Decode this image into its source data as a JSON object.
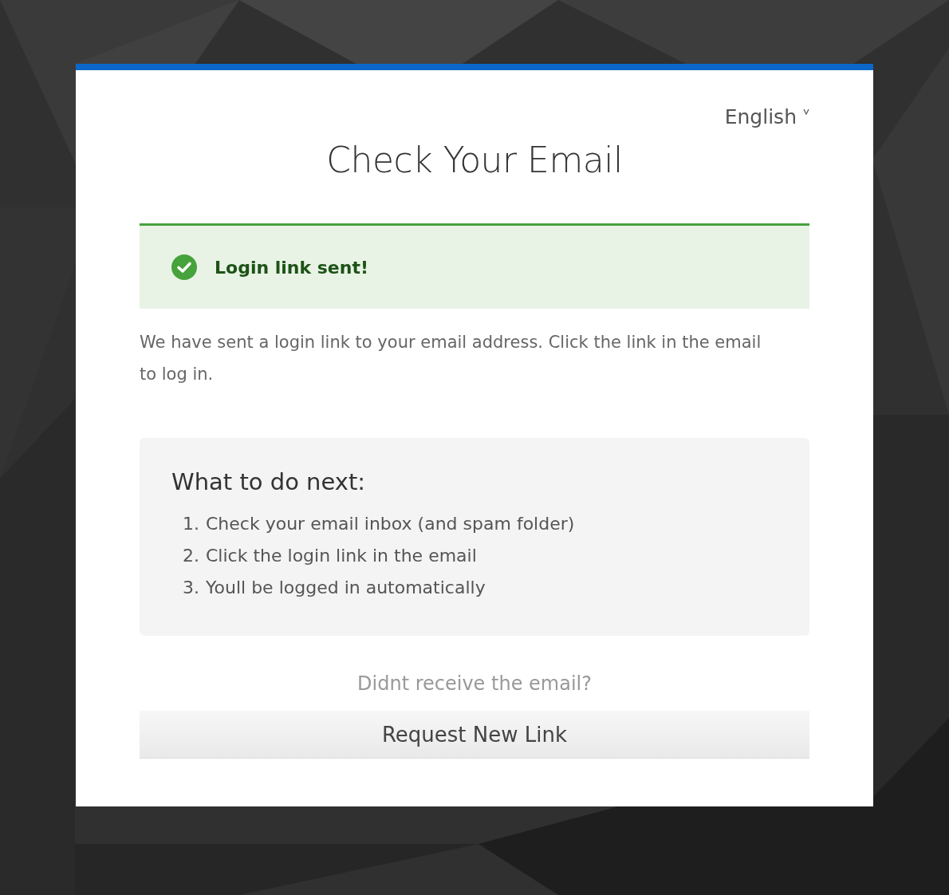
{
  "language": {
    "label": "English"
  },
  "title": "Check Your Email",
  "alert": {
    "kind": "success",
    "message": "Login link sent!"
  },
  "description": "We have sent a login link to your email address. Click the link in the email to log in.",
  "next_steps": {
    "heading": "What to do next:",
    "items": [
      {
        "number": "1.",
        "text": "Check your email inbox (and spam folder)"
      },
      {
        "number": "2.",
        "text": "Click the login link in the email"
      },
      {
        "number": "3.",
        "text": "Youll be logged in automatically"
      }
    ]
  },
  "resend": {
    "prompt": "Didnt receive the email?",
    "button": "Request New Link"
  }
}
